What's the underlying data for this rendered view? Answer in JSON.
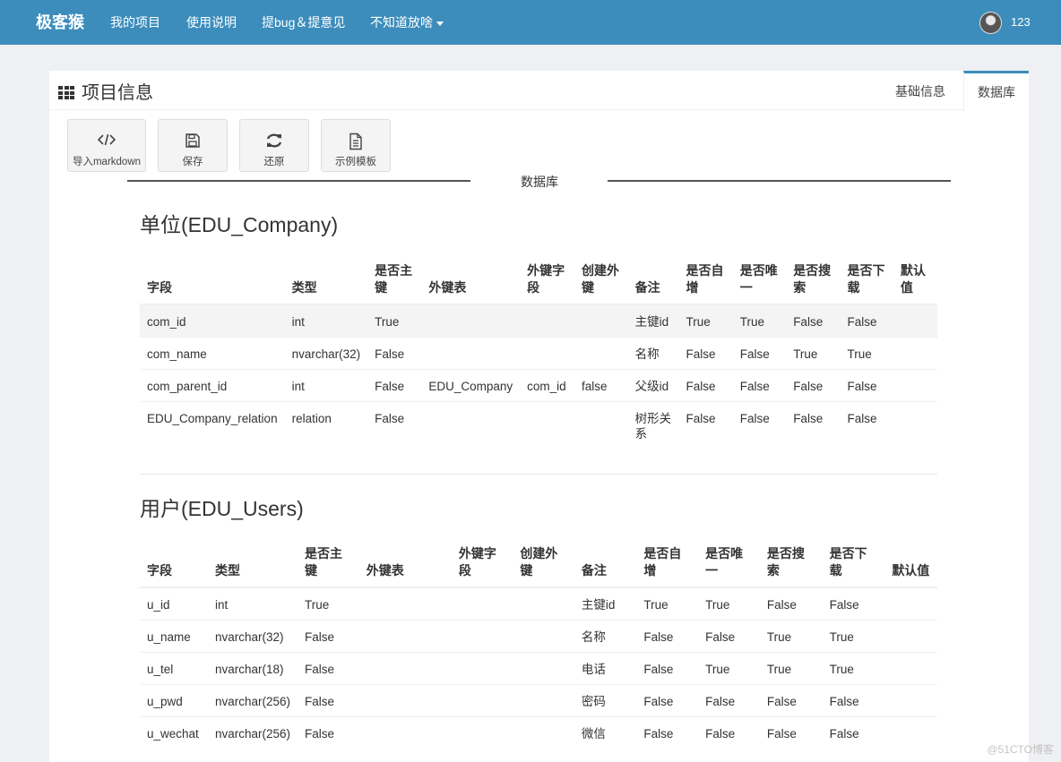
{
  "navbar": {
    "brand": "极客猴",
    "links": [
      "我的项目",
      "使用说明",
      "提bug＆提意见",
      "不知道放啥"
    ],
    "username": "123"
  },
  "panel": {
    "title": "项目信息",
    "tabs": [
      "基础信息",
      "数据库"
    ],
    "active_tab": "数据库"
  },
  "toolbar": {
    "buttons": [
      "导入markdown",
      "保存",
      "还原",
      "示例模板"
    ]
  },
  "divider_label": "数据库",
  "tables": [
    {
      "title": "单位(EDU_Company)",
      "headers": [
        "字段",
        "类型",
        "是否主键",
        "外键表",
        "外键字段",
        "创建外键",
        "备注",
        "是否自增",
        "是否唯一",
        "是否搜索",
        "是否下载",
        "默认值"
      ],
      "rows": [
        [
          "com_id",
          "int",
          "True",
          "",
          "",
          "",
          "主键id",
          "True",
          "True",
          "False",
          "False",
          ""
        ],
        [
          "com_name",
          "nvarchar(32)",
          "False",
          "",
          "",
          "",
          "名称",
          "False",
          "False",
          "True",
          "True",
          ""
        ],
        [
          "com_parent_id",
          "int",
          "False",
          "EDU_Company",
          "com_id",
          "false",
          "父级id",
          "False",
          "False",
          "False",
          "False",
          ""
        ],
        [
          "EDU_Company_relation",
          "relation",
          "False",
          "",
          "",
          "",
          "树形关系",
          "False",
          "False",
          "False",
          "False",
          ""
        ]
      ]
    },
    {
      "title": "用户(EDU_Users)",
      "headers": [
        "字段",
        "类型",
        "是否主键",
        "外键表",
        "外键字段",
        "创建外键",
        "备注",
        "是否自增",
        "是否唯一",
        "是否搜索",
        "是否下载",
        "默认值"
      ],
      "rows": [
        [
          "u_id",
          "int",
          "True",
          "",
          "",
          "",
          "主键id",
          "True",
          "True",
          "False",
          "False",
          ""
        ],
        [
          "u_name",
          "nvarchar(32)",
          "False",
          "",
          "",
          "",
          "名称",
          "False",
          "False",
          "True",
          "True",
          ""
        ],
        [
          "u_tel",
          "nvarchar(18)",
          "False",
          "",
          "",
          "",
          "电话",
          "False",
          "True",
          "True",
          "True",
          ""
        ],
        [
          "u_pwd",
          "nvarchar(256)",
          "False",
          "",
          "",
          "",
          "密码",
          "False",
          "False",
          "False",
          "False",
          ""
        ],
        [
          "u_wechat",
          "nvarchar(256)",
          "False",
          "",
          "",
          "",
          "微信",
          "False",
          "False",
          "False",
          "False",
          ""
        ]
      ]
    }
  ],
  "watermark": "@51CTO博客"
}
